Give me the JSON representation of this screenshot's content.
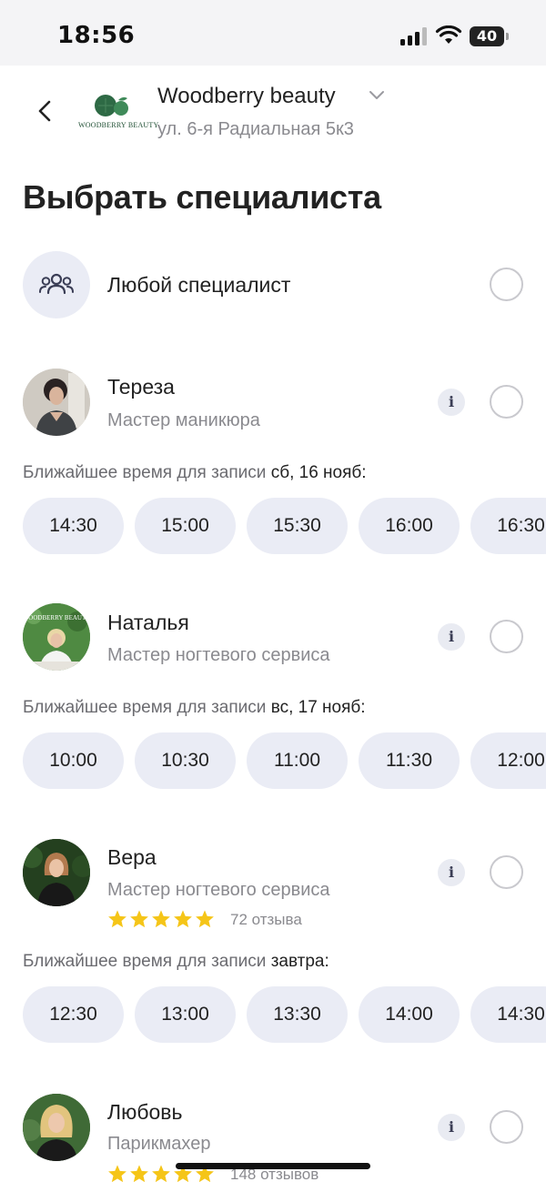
{
  "status_bar": {
    "time": "18:56",
    "battery": "40"
  },
  "header": {
    "logo_text": "WOODBERRY BEAUTY",
    "salon_name": "Woodberry beauty",
    "address": "ул. 6-я Радиальная 5к3"
  },
  "page_title": "Выбрать специалиста",
  "any_specialist": {
    "label": "Любой специалист"
  },
  "nearest_label": "Ближайшее время для записи",
  "specialists": [
    {
      "name": "Тереза",
      "role": "Мастер маникюра",
      "info": "i",
      "nearest_date": "сб, 16 нояб:",
      "slots": [
        "14:30",
        "15:00",
        "15:30",
        "16:00",
        "16:30"
      ]
    },
    {
      "name": "Наталья",
      "role": "Мастер ногтевого сервиса",
      "info": "i",
      "nearest_date": "вс, 17 нояб:",
      "slots": [
        "10:00",
        "10:30",
        "11:00",
        "11:30",
        "12:00"
      ]
    },
    {
      "name": "Вера",
      "role": "Мастер ногтевого сервиса",
      "info": "i",
      "rating": 5,
      "reviews": "72 отзыва",
      "nearest_date": "завтра:",
      "slots": [
        "12:30",
        "13:00",
        "13:30",
        "14:00",
        "14:30"
      ]
    },
    {
      "name": "Любовь",
      "role": "Парикмахер",
      "info": "i",
      "rating": 5,
      "reviews": "148 отзывов"
    }
  ],
  "colors": {
    "accent_slot": "#eaecf5",
    "star": "#f5c518",
    "muted_text": "#8a8a8f"
  }
}
